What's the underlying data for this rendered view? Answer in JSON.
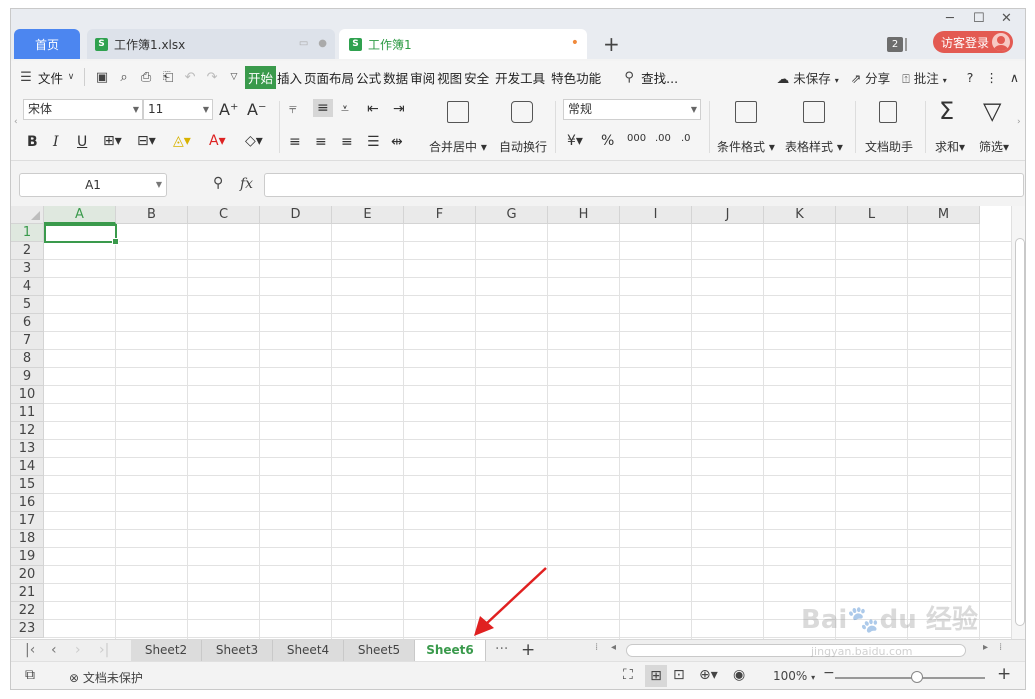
{
  "tabs": {
    "home": "首页",
    "file": "工作簿1.xlsx",
    "book": "工作簿1",
    "new_tab": "+",
    "window_count": "2",
    "login": "访客登录"
  },
  "menu": {
    "file": "文件",
    "items": [
      "开始",
      "插入",
      "页面布局",
      "公式",
      "数据",
      "审阅",
      "视图",
      "安全",
      "开发工具",
      "特色功能"
    ],
    "search": "查找...",
    "unsaved": "未保存",
    "share": "分享",
    "comment": "批注"
  },
  "ribbon": {
    "font_name": "宋体",
    "font_size": "11",
    "number_format": "常规",
    "merge_center": "合并居中",
    "auto_wrap": "自动换行",
    "cond_format": "条件格式",
    "table_style": "表格样式",
    "doc_helper": "文档助手",
    "sum": "求和",
    "filter": "筛选"
  },
  "formula_bar": {
    "name_box": "A1",
    "fx": "fx",
    "formula": ""
  },
  "grid": {
    "columns": [
      "A",
      "B",
      "C",
      "D",
      "E",
      "F",
      "G",
      "H",
      "I",
      "J",
      "K",
      "L",
      "M"
    ],
    "rows": [
      "1",
      "2",
      "3",
      "4",
      "5",
      "6",
      "7",
      "8",
      "9",
      "10",
      "11",
      "12",
      "13",
      "14",
      "15",
      "16",
      "17",
      "18",
      "19",
      "20",
      "21",
      "22",
      "23"
    ],
    "active_cell": "A1"
  },
  "sheets": {
    "tabs": [
      "Sheet2",
      "Sheet3",
      "Sheet4",
      "Sheet5",
      "Sheet6"
    ],
    "active": "Sheet6",
    "more": "···",
    "add": "+"
  },
  "status": {
    "protection": "文档未保护",
    "zoom": "100%"
  },
  "watermark": {
    "brand": "Bai",
    "brand2": "du",
    "brand_cn": "经验",
    "url": "jingyan.baidu.com"
  },
  "colors": {
    "accent_green": "#3a9a4c",
    "home_tab_blue": "#4c86f0",
    "login_red": "#e35a52",
    "annotation_arrow": "#e02020"
  }
}
